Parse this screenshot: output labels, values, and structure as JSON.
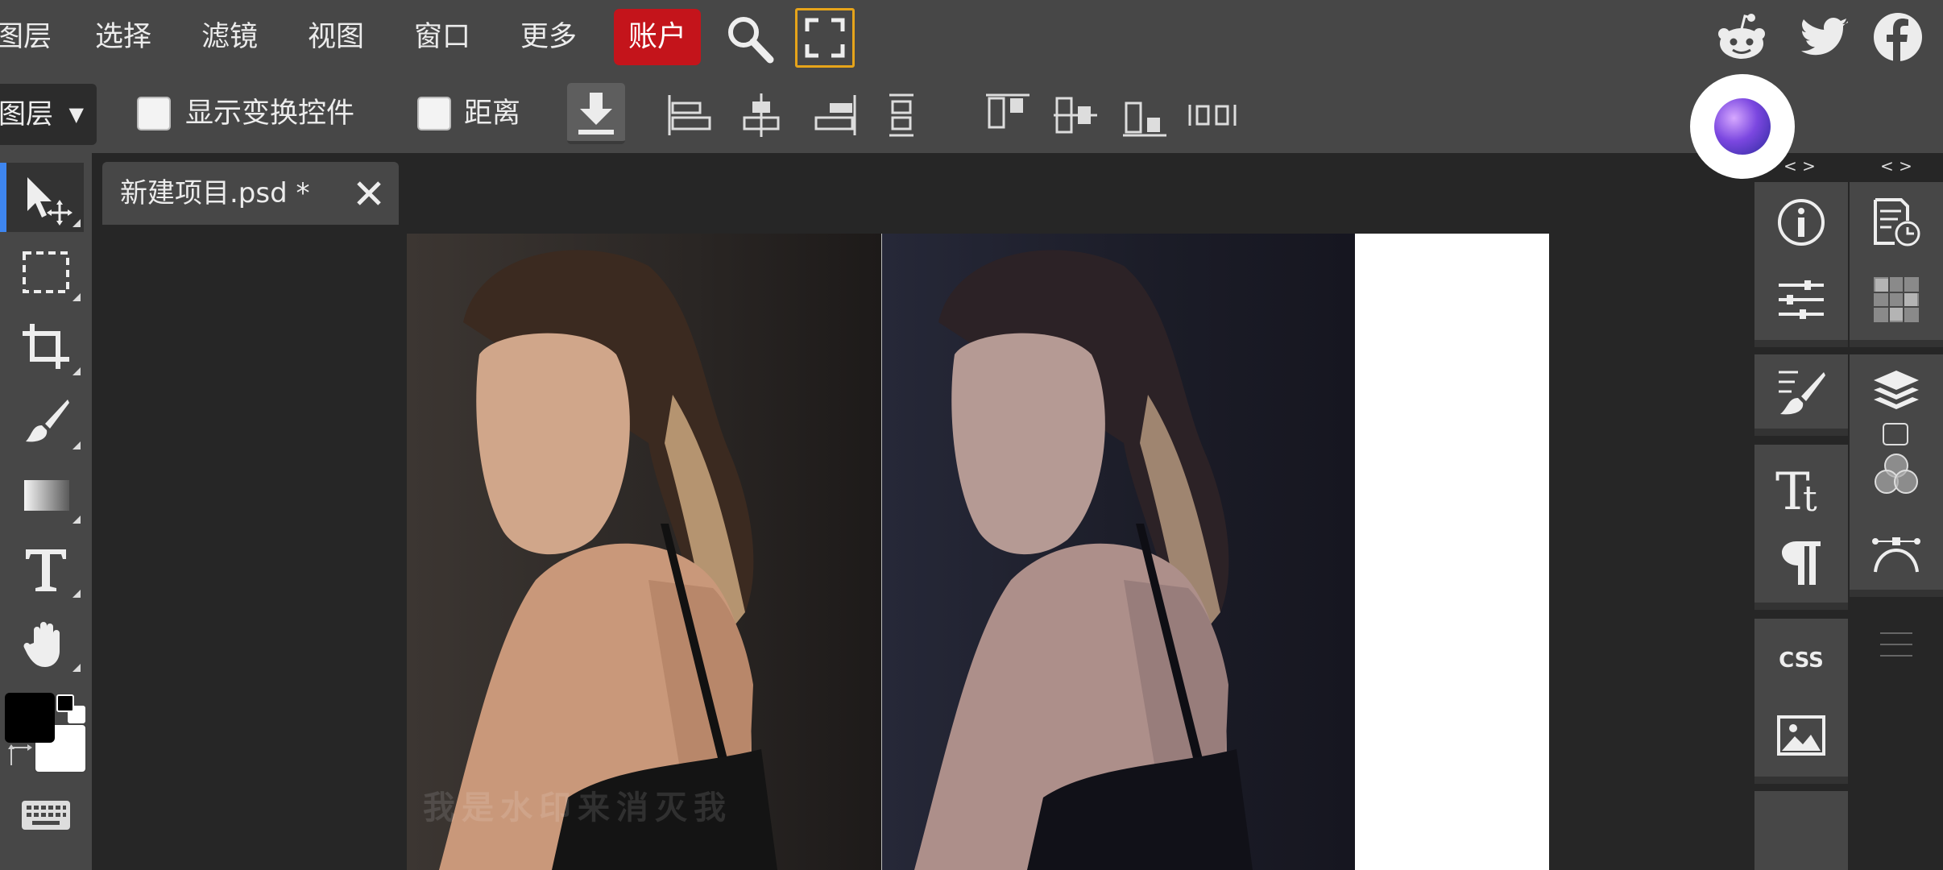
{
  "menu": {
    "items": [
      "图层",
      "选择",
      "滤镜",
      "视图",
      "窗口",
      "更多"
    ],
    "account": "账户"
  },
  "options": {
    "layer_select": "图层",
    "show_transform_label": "显示变换控件",
    "distance_label": "距离"
  },
  "document": {
    "tab_title": "新建项目.psd *",
    "watermark": "我是水印来消灭我"
  },
  "panels": {
    "expand_left": "< >",
    "expand_right": "< >",
    "css_label": "CSS"
  },
  "colors": {
    "accent": "#3e86f0",
    "account_red": "#c4141b",
    "fullscreen_border": "#e6a41a",
    "foreground": "#000000",
    "background": "#ffffff"
  }
}
